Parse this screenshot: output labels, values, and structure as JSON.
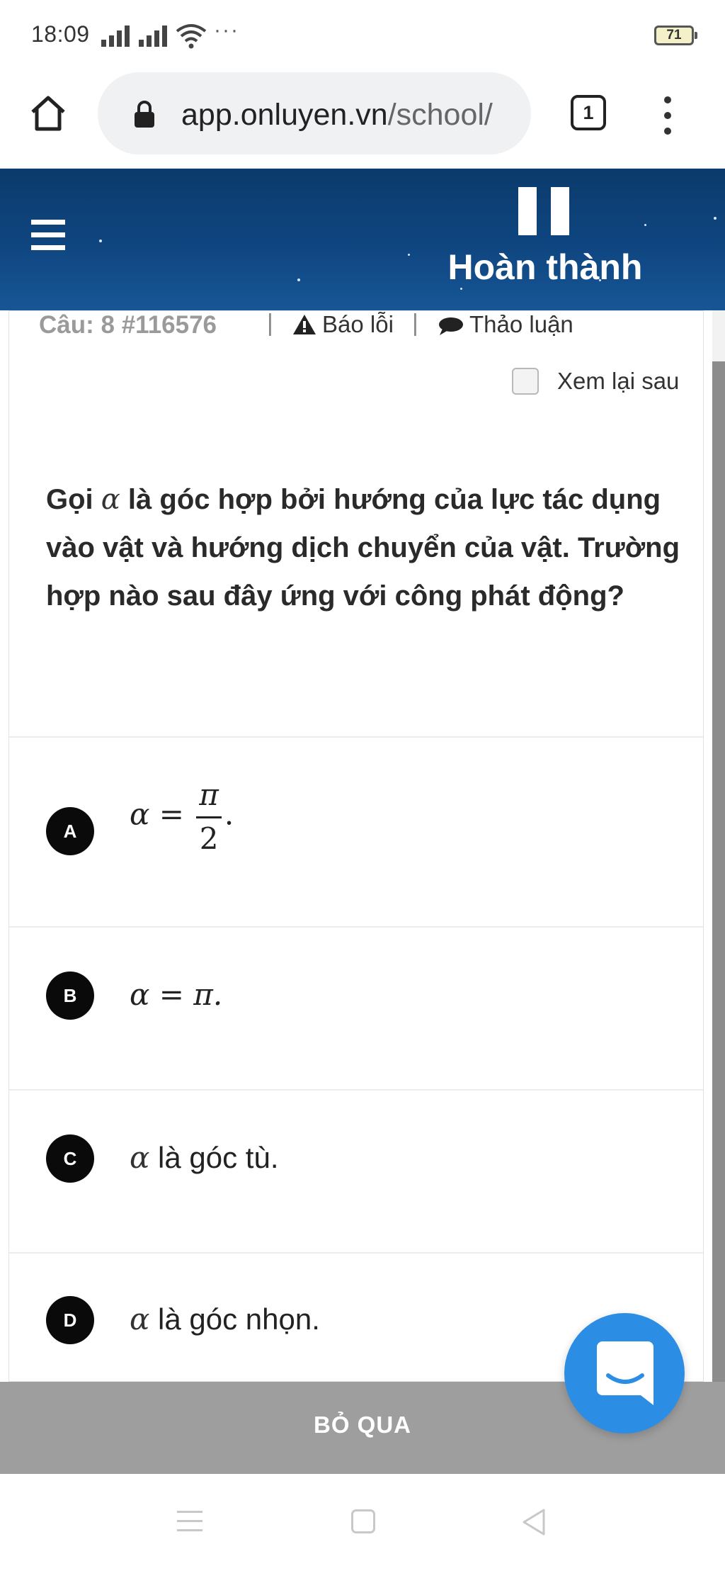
{
  "status_bar": {
    "time": "18:09",
    "more": "···",
    "battery": "71"
  },
  "browser": {
    "url_host": "app.onluyen.vn",
    "url_path": "/school/",
    "tab_count": "1"
  },
  "header": {
    "finish_label": "Hoàn thành"
  },
  "question": {
    "number_label": "Câu: 8 #116576",
    "separator": "|",
    "report_label": "Báo lỗi",
    "discuss_label": "Thảo luận",
    "review_later_label": "Xem lại sau",
    "review_later_checked": false,
    "text_part1": "Gọi ",
    "alpha": "α",
    "text_part2": " là góc hợp bởi hướng của lực tác dụng vào vật và hướng dịch chuyển của vật. Trường hợp nào sau đây ứng với công phát động?"
  },
  "options": {
    "a": {
      "letter": "A",
      "alpha": "α",
      "equals": " = ",
      "numerator": "π",
      "denominator": "2",
      "tail": "."
    },
    "b": {
      "letter": "B",
      "text": "α = π."
    },
    "c": {
      "letter": "C",
      "alpha": "α",
      "text": " là góc tù."
    },
    "d": {
      "letter": "D",
      "alpha": "α",
      "text": " là góc nhọn."
    }
  },
  "footer": {
    "skip_label": "BỎ QUA"
  },
  "colors": {
    "header_blue": "#0f4680",
    "skip_gray": "#9e9e9e",
    "chat_blue": "#2b8de3",
    "option_badge": "#0a0a0a"
  },
  "icons": {
    "home": "home-icon",
    "lock": "lock-icon",
    "tabs": "tabs-icon",
    "menu": "more-vertical-icon",
    "hamburger": "hamburger-icon",
    "pause": "pause-icon",
    "report": "warning-icon",
    "discuss": "chat-bubble-icon",
    "chat": "messenger-chat-icon"
  }
}
